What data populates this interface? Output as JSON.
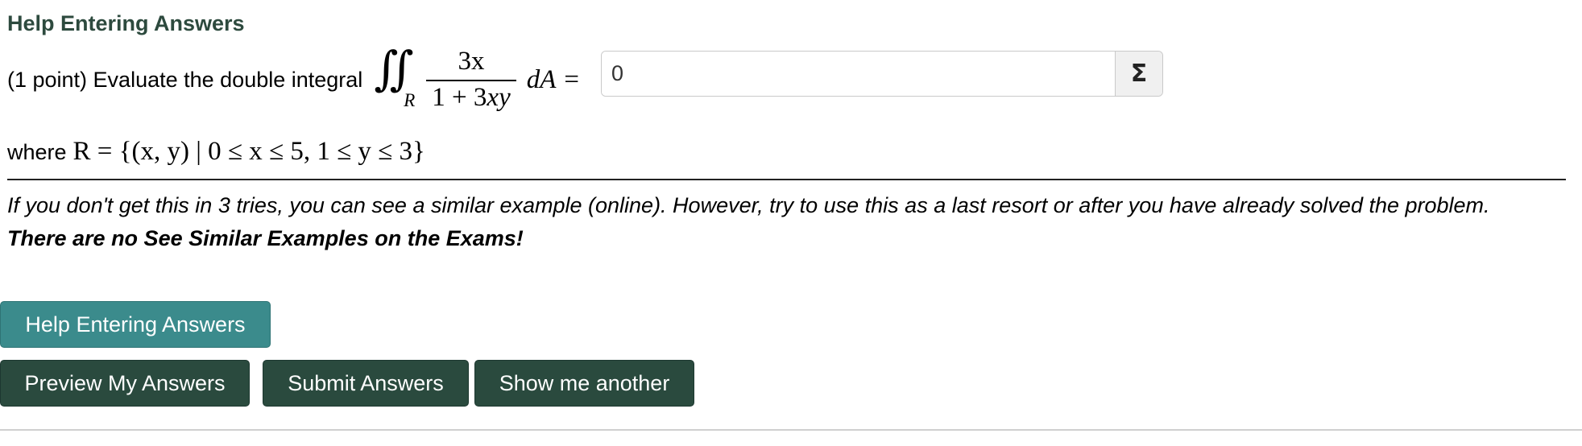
{
  "heading": "Help Entering Answers",
  "problem": {
    "prefix": "(1 point) Evaluate the double integral",
    "integral_sign": "∬",
    "region_sub": "R",
    "numerator": "3x",
    "denominator_plain": "1 + 3",
    "denominator_var": "xy",
    "differential": "dA",
    "equals": "="
  },
  "answer": {
    "value": "0",
    "sigma_label": "Σ"
  },
  "where": {
    "word": "where",
    "expression": "R = {(x, y) | 0 ≤ x ≤ 5, 1 ≤ y ≤ 3}"
  },
  "notes": {
    "italic": "If you don't get this in 3 tries, you can see a similar example (online). However, try to use this as a last resort or after you have already solved the problem.",
    "bold": "There are no See Similar Examples on the Exams!"
  },
  "buttons": {
    "help": "Help Entering Answers",
    "preview": "Preview My Answers",
    "submit": "Submit Answers",
    "another": "Show me another"
  }
}
